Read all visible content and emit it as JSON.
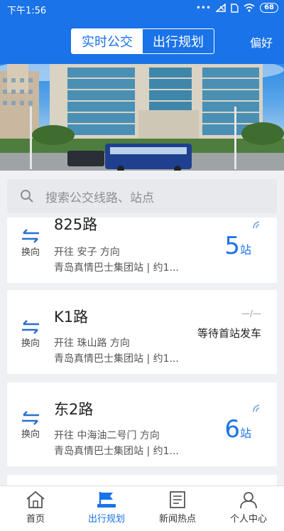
{
  "status": {
    "time": "下午1:56",
    "battery": "68"
  },
  "header": {
    "tabs": [
      {
        "label": "实时公交",
        "active": true
      },
      {
        "label": "出行规划",
        "active": false
      }
    ],
    "preference": "偏好"
  },
  "search": {
    "placeholder": "搜索公交线路、站点"
  },
  "cards": [
    {
      "route": "825路",
      "direction": "开往 安子 方向",
      "company": "青岛真情巴士集团站 | 约1...",
      "swap": "换向",
      "eta_number": "5",
      "eta_unit": "站"
    },
    {
      "route": "K1路",
      "direction": "开往 珠山路 方向",
      "company": "青岛真情巴士集团站 | 约1...",
      "swap": "换向",
      "waiting": "等待首站发车",
      "dash": "—/—"
    },
    {
      "route": "东2路",
      "direction": "开往 中海油二号门 方向",
      "company": "青岛真情巴士集团站 | 约1...",
      "swap": "换向",
      "eta_number": "6",
      "eta_unit": "站"
    }
  ],
  "nav": [
    {
      "label": "首页",
      "icon": "home-icon"
    },
    {
      "label": "出行规划",
      "icon": "flag-icon",
      "active": true
    },
    {
      "label": "新闻热点",
      "icon": "news-icon"
    },
    {
      "label": "个人中心",
      "icon": "person-icon"
    }
  ],
  "colors": {
    "primary": "#1a73e8"
  }
}
